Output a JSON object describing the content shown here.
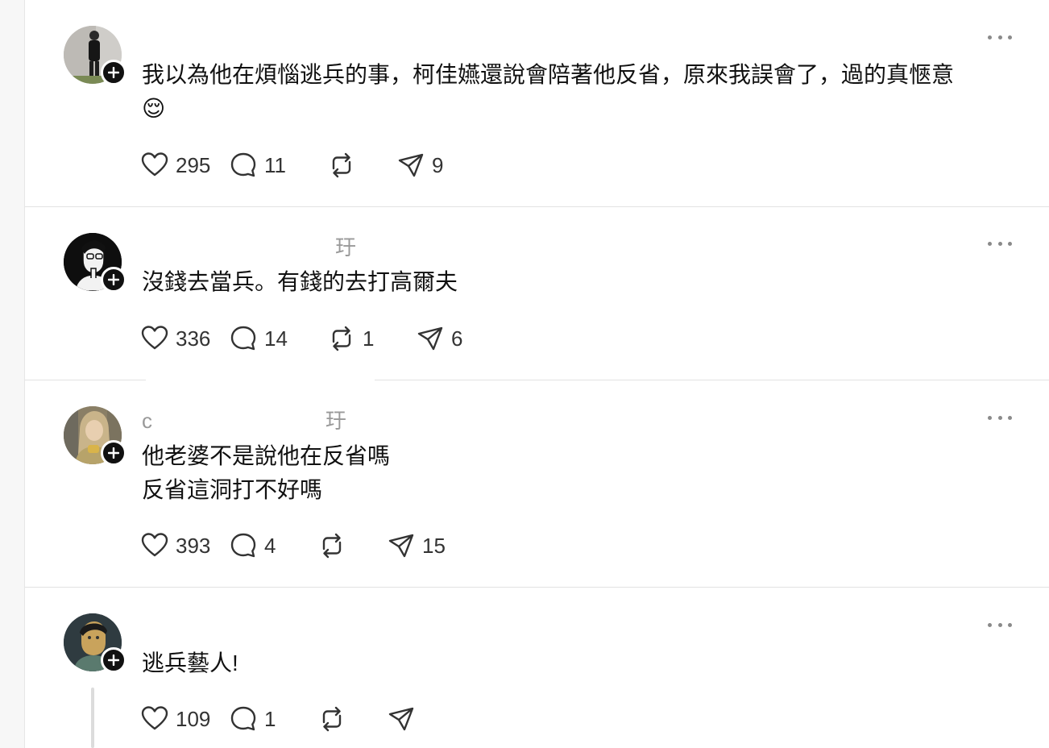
{
  "posts": [
    {
      "username": "",
      "text": "我以為他在煩惱逃兵的事，柯佳嬿還說會陪著他反省，原來我誤會了，過的真愜意\n😌",
      "likes": "295",
      "replies": "11",
      "reposts": "",
      "shares": "9"
    },
    {
      "username": "玗",
      "text": "沒錢去當兵。有錢的去打高爾夫",
      "likes": "336",
      "replies": "14",
      "reposts": "1",
      "shares": "6"
    },
    {
      "username": "c                          玗",
      "text": "他老婆不是說他在反省嗎\n反省這洞打不好嗎",
      "likes": "393",
      "replies": "4",
      "reposts": "",
      "shares": "15"
    },
    {
      "username": "",
      "text": "逃兵藝人!",
      "likes": "109",
      "replies": "1",
      "reposts": "",
      "shares": ""
    }
  ],
  "icons": {
    "like": "heart-icon",
    "reply": "comment-icon",
    "repost": "repost-icon",
    "share": "send-icon",
    "more": "more-icon",
    "follow": "plus-icon"
  },
  "colors": {
    "text": "#111111",
    "muted": "#999999",
    "divider": "#e2e2e2",
    "badge": "#111111"
  }
}
